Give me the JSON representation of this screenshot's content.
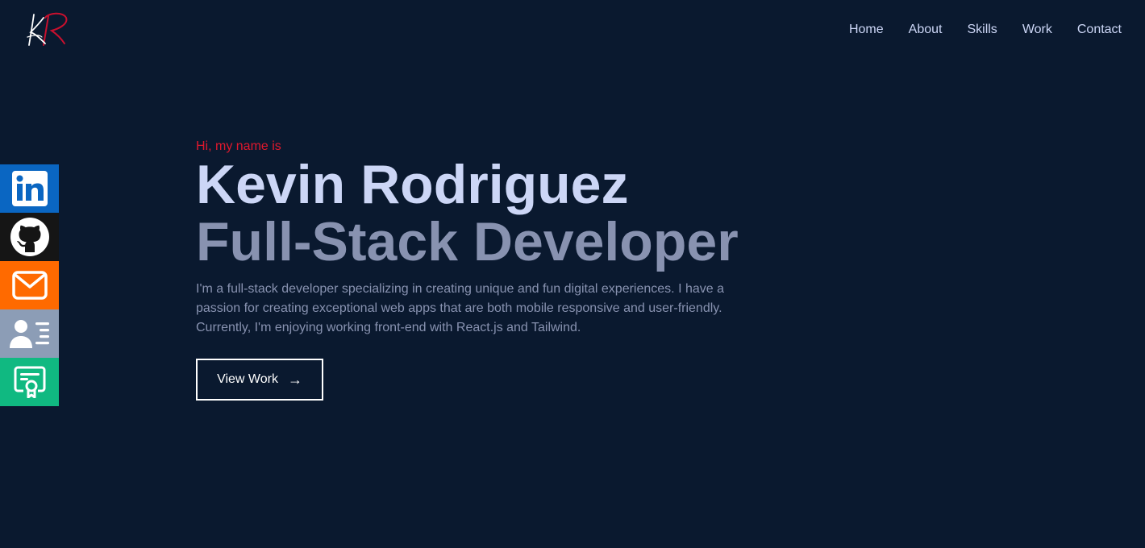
{
  "logo": {
    "text": "KR"
  },
  "nav": {
    "items": [
      "Home",
      "About",
      "Skills",
      "Work",
      "Contact"
    ]
  },
  "social": {
    "items": [
      {
        "icon": "linkedin-icon",
        "color": "#0a66c2"
      },
      {
        "icon": "github-icon",
        "color": "#151515"
      },
      {
        "icon": "email-icon",
        "color": "#ff6a00"
      },
      {
        "icon": "resume-icon",
        "color": "#8c9db6"
      },
      {
        "icon": "certificate-icon",
        "color": "#10b981"
      }
    ]
  },
  "hero": {
    "greeting": "Hi, my name is",
    "name": "Kevin Rodriguez",
    "role": "Full-Stack Developer",
    "description": "I'm a full-stack developer specializing in creating unique and fun digital experiences. I have a passion for creating exceptional web apps that are both mobile responsive and user-friendly. Currently, I'm enjoying working front-end with React.js and Tailwind.",
    "cta_label": "View Work",
    "cta_arrow": "→"
  },
  "colors": {
    "background": "#0a192f",
    "accent": "#e0182d",
    "heading": "#ccd6f6",
    "muted": "#8892b0"
  }
}
